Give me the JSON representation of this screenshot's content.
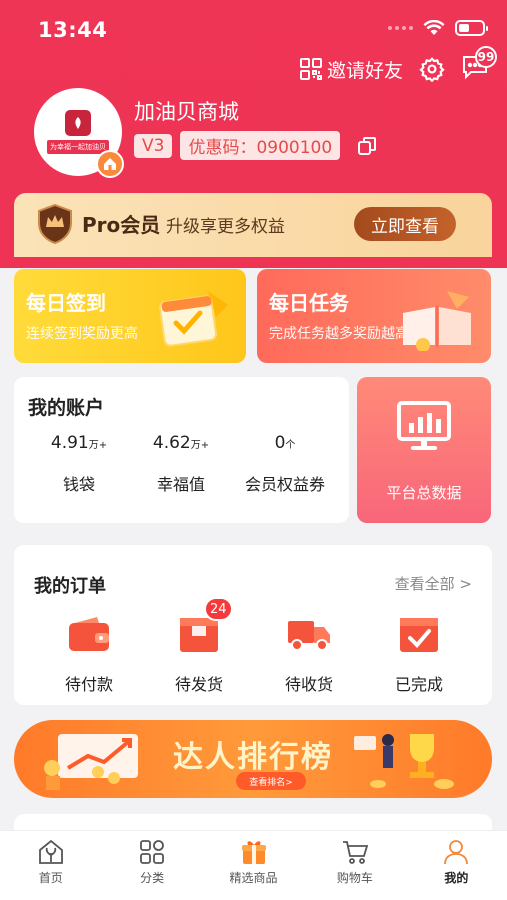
{
  "status": {
    "time": "13:44"
  },
  "header": {
    "invite_label": "邀请好友",
    "message_badge": "99",
    "shop_name": "加油贝商城",
    "avatar_ribbon": "为幸福一起加油贝",
    "level": "V3",
    "coupon_code": "优惠码：0900100"
  },
  "pro": {
    "title": "Pro会员",
    "subtitle": "升级享更多权益",
    "button": "立即查看"
  },
  "daily_sign": {
    "title": "每日签到",
    "subtitle": "连续签到奖励更高"
  },
  "daily_task": {
    "title": "每日任务",
    "subtitle": "完成任务越多奖励越高"
  },
  "account": {
    "title": "我的账户",
    "items": [
      {
        "value": "4.91",
        "unit": "万+",
        "label": "钱袋"
      },
      {
        "value": "4.62",
        "unit": "万+",
        "label": "幸福值"
      },
      {
        "value": "0",
        "unit": "个",
        "label": "会员权益券"
      }
    ]
  },
  "platform": {
    "label": "平台总数据"
  },
  "orders": {
    "title": "我的订单",
    "view_all": "查看全部 >",
    "items": [
      {
        "label": "待付款",
        "badge": ""
      },
      {
        "label": "待发货",
        "badge": "24"
      },
      {
        "label": "待收货",
        "badge": ""
      },
      {
        "label": "已完成",
        "badge": ""
      }
    ]
  },
  "ranking": {
    "title": "达人排行榜",
    "button": "查看排名>"
  },
  "tabbar": {
    "items": [
      {
        "label": "首页",
        "icon": "home-icon"
      },
      {
        "label": "分类",
        "icon": "category-icon"
      },
      {
        "label": "精选商品",
        "icon": "gift-icon"
      },
      {
        "label": "购物车",
        "icon": "cart-icon"
      },
      {
        "label": "我的",
        "icon": "user-icon"
      }
    ],
    "active": "我的"
  },
  "colors": {
    "brand": "#ee3354",
    "accent": "#fa8a3a"
  }
}
